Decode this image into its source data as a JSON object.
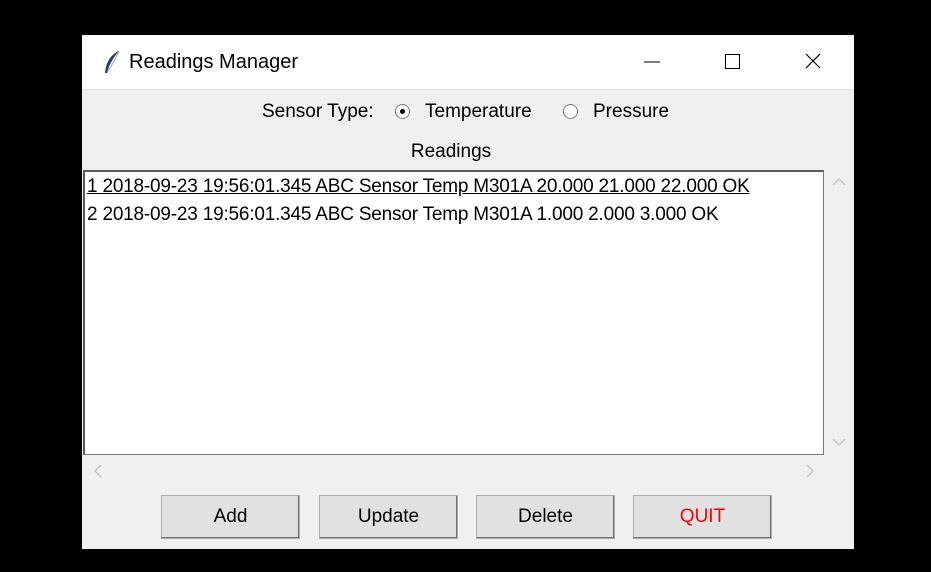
{
  "window": {
    "title": "Readings Manager"
  },
  "sensor": {
    "label": "Sensor Type:",
    "options": [
      {
        "label": "Temperature",
        "selected": true
      },
      {
        "label": "Pressure",
        "selected": false
      }
    ]
  },
  "readings": {
    "label": "Readings",
    "items": [
      "1 2018-09-23 19:56:01.345 ABC Sensor Temp M301A 20.000 21.000 22.000 OK",
      "2 2018-09-23 19:56:01.345 ABC Sensor Temp M301A 1.000 2.000 3.000 OK"
    ],
    "selected_index": 0
  },
  "buttons": {
    "add": "Add",
    "update": "Update",
    "delete": "Delete",
    "quit": "QUIT"
  },
  "colors": {
    "quit_text": "#ff0000",
    "window_bg": "#f0f0f0"
  },
  "icons": {
    "app": "feather-icon",
    "minimize": "minimize-icon",
    "maximize": "maximize-icon",
    "close": "close-icon"
  }
}
